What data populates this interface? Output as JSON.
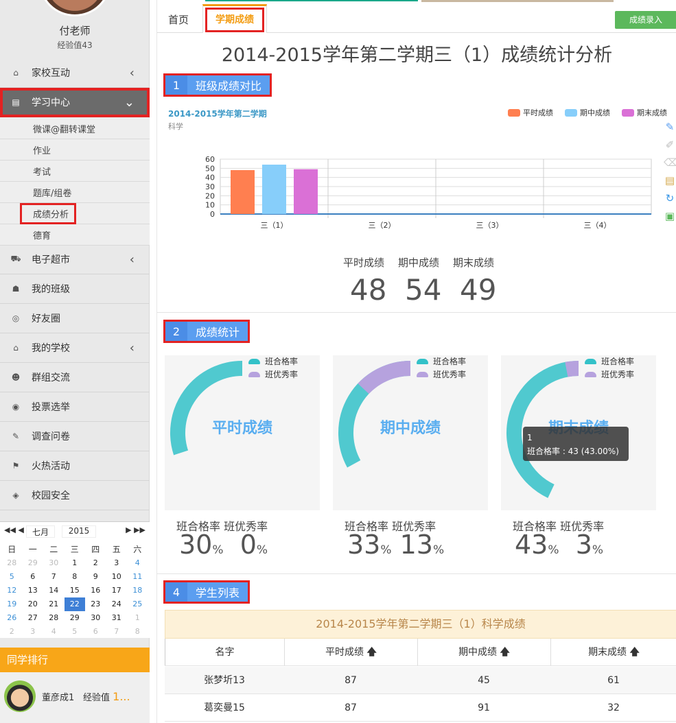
{
  "sidebar": {
    "teacher_name": "付老师",
    "teacher_exp": "经验值43",
    "nav": [
      {
        "label": "家校互动",
        "icon": "home-icon",
        "glyph": "⌂",
        "chevron": "‹"
      },
      {
        "label": "学习中心",
        "icon": "book-icon",
        "glyph": "▤",
        "chevron": "⌄"
      },
      {
        "label": "电子超市",
        "icon": "cart-icon",
        "glyph": "⛟",
        "chevron": "‹"
      },
      {
        "label": "我的班级",
        "icon": "class-icon",
        "glyph": "☗",
        "chevron": ""
      },
      {
        "label": "好友圈",
        "icon": "aperture-icon",
        "glyph": "◎",
        "chevron": ""
      },
      {
        "label": "我的学校",
        "icon": "school-icon",
        "glyph": "⌂",
        "chevron": "‹"
      },
      {
        "label": "群组交流",
        "icon": "group-icon",
        "glyph": "☻",
        "chevron": ""
      },
      {
        "label": "投票选举",
        "icon": "vote-icon",
        "glyph": "◉",
        "chevron": ""
      },
      {
        "label": "调查问卷",
        "icon": "survey-icon",
        "glyph": "✎",
        "chevron": ""
      },
      {
        "label": "火热活动",
        "icon": "flag-icon",
        "glyph": "⚑",
        "chevron": ""
      },
      {
        "label": "校园安全",
        "icon": "shield-icon",
        "glyph": "◈",
        "chevron": ""
      }
    ],
    "subnav": [
      "微课@翻转课堂",
      "作业",
      "考试",
      "题库/组卷",
      "成绩分析",
      "德育"
    ],
    "calendar": {
      "month": "七月",
      "year": "2015",
      "nav_prev": "◀◀ ◀",
      "nav_next": "▶ ▶▶",
      "weekdays": [
        "日",
        "一",
        "二",
        "三",
        "四",
        "五",
        "六"
      ],
      "weeks": [
        [
          "28",
          "29",
          "30",
          "1",
          "2",
          "3",
          "4"
        ],
        [
          "5",
          "6",
          "7",
          "8",
          "9",
          "10",
          "11"
        ],
        [
          "12",
          "13",
          "14",
          "15",
          "16",
          "17",
          "18"
        ],
        [
          "19",
          "20",
          "21",
          "22",
          "23",
          "24",
          "25"
        ],
        [
          "26",
          "27",
          "28",
          "29",
          "30",
          "31",
          "1"
        ],
        [
          "2",
          "3",
          "4",
          "5",
          "6",
          "7",
          "8"
        ]
      ],
      "today": "22"
    },
    "ranking": {
      "title": "同学排行",
      "name": "董彦成1",
      "exp_label": "经验值",
      "exp_value": "1..."
    }
  },
  "main": {
    "tab_home": "首页",
    "tab_term": "学期成绩",
    "entry_button": "成绩录入",
    "page_title": "2014-2015学年第二学期三（1）成绩统计分析",
    "sections": [
      {
        "num": "1",
        "title": "班级成绩对比"
      },
      {
        "num": "2",
        "title": "成绩统计"
      },
      {
        "num": "4",
        "title": "学生列表"
      }
    ],
    "score_labels": [
      "平时成绩",
      "期中成绩",
      "期末成绩"
    ],
    "score_values": [
      "48",
      "54",
      "49"
    ],
    "toolbox": [
      "✎",
      "✐",
      "⌫",
      "▤",
      "↻",
      "▣"
    ],
    "gauges": [
      {
        "label": "平时成绩",
        "pass": 30,
        "excellent": 0,
        "pass_text": "30",
        "excellent_text": "0"
      },
      {
        "label": "期中成绩",
        "pass": 33,
        "excellent": 13,
        "pass_text": "33",
        "excellent_text": "13"
      },
      {
        "label": "期末成绩",
        "pass": 43,
        "excellent": 3,
        "pass_text": "43",
        "excellent_text": "3"
      }
    ],
    "gauge_legend": [
      "班合格率",
      "班优秀率"
    ],
    "rate_labels": "班合格率 班优秀率",
    "percent": "%",
    "tooltip": {
      "line1": "1",
      "line2": "班合格率 : 43 (43.00%)"
    },
    "table": {
      "title": "2014-2015学年第二学期三（1）科学成绩",
      "headers": [
        "名字",
        "平时成绩",
        "期中成绩",
        "期末成绩"
      ],
      "sort_icon": "🡅",
      "rows": [
        [
          "张梦圻13",
          "87",
          "45",
          "61"
        ],
        [
          "葛奕曼15",
          "87",
          "91",
          "32"
        ]
      ]
    }
  },
  "colors": {
    "normal": "#ff7f50",
    "midterm": "#87cefa",
    "final": "#da70d6",
    "pass_ring": "#33c1c8",
    "excellent_ring": "#b6a2de",
    "accent": "#f39c12",
    "highlight": "#e32222"
  },
  "chart_data": {
    "type": "bar",
    "title": "2014-2015学年第二学期",
    "subtitle": "科学",
    "categories": [
      "三（1）",
      "三（2）",
      "三（3）",
      "三（4）"
    ],
    "series": [
      {
        "name": "平时成绩",
        "values": [
          48,
          null,
          null,
          null
        ]
      },
      {
        "name": "期中成绩",
        "values": [
          54,
          null,
          null,
          null
        ]
      },
      {
        "name": "期末成绩",
        "values": [
          49,
          null,
          null,
          null
        ]
      }
    ],
    "ylim": [
      0,
      60
    ],
    "yticks": [
      0,
      10,
      20,
      30,
      40,
      50,
      60
    ],
    "grid": true,
    "legend": "top-right"
  }
}
